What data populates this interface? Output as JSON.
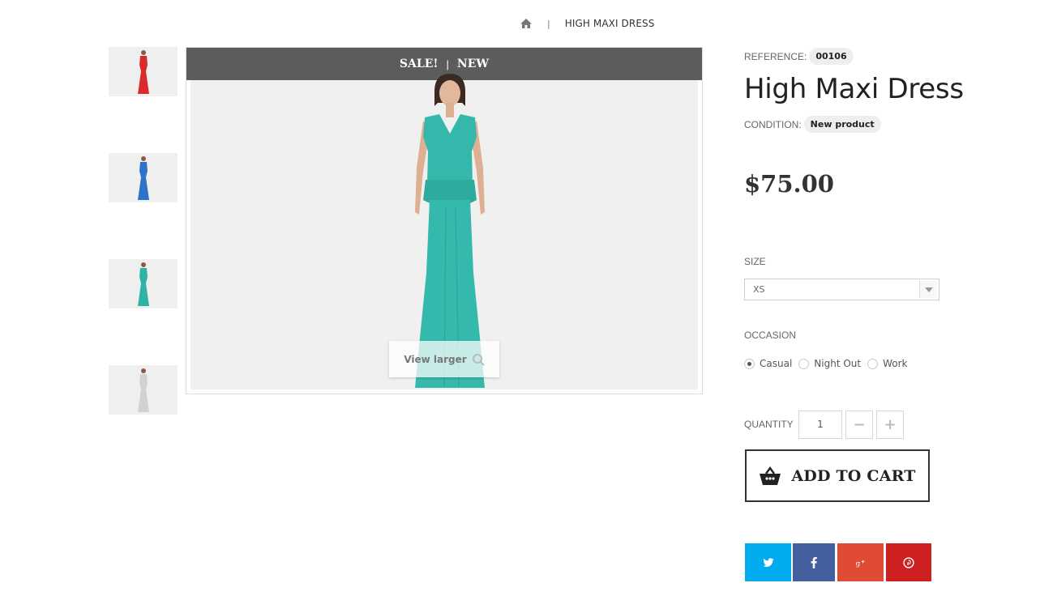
{
  "breadcrumb": {
    "home_icon": "home-icon",
    "separator": "|",
    "current": "HIGH MAXI DRESS"
  },
  "gallery": {
    "thumbnails": [
      {
        "name": "red dress",
        "color": "#d92b2b"
      },
      {
        "name": "blue dress",
        "color": "#2f72c9"
      },
      {
        "name": "teal dress",
        "color": "#2fb3a4"
      },
      {
        "name": "white dress",
        "color": "#dcdcd8"
      }
    ],
    "badges": {
      "sale": "SALE!",
      "separator": "|",
      "new": "NEW"
    },
    "main_color": "#36b9ad",
    "view_larger": "View larger"
  },
  "product": {
    "reference_label": "REFERENCE:",
    "reference": "00106",
    "title": "High Maxi Dress",
    "condition_label": "CONDITION:",
    "condition": "New product",
    "price": "$75.00"
  },
  "size": {
    "label": "SIZE",
    "selected": "XS"
  },
  "occasion": {
    "label": "OCCASION",
    "options": [
      {
        "label": "Casual",
        "checked": true
      },
      {
        "label": "Night Out",
        "checked": false
      },
      {
        "label": "Work",
        "checked": false
      }
    ]
  },
  "quantity": {
    "label": "QUANTITY",
    "value": "1",
    "minus": "−",
    "plus": "+"
  },
  "cart": {
    "label": "ADD TO CART",
    "icon": "basket-icon"
  },
  "social": [
    {
      "name": "twitter",
      "color": "#00aced"
    },
    {
      "name": "facebook",
      "color": "#435f9f"
    },
    {
      "name": "google-plus",
      "color": "#e04b34"
    },
    {
      "name": "pinterest",
      "color": "#ce1f21"
    }
  ]
}
